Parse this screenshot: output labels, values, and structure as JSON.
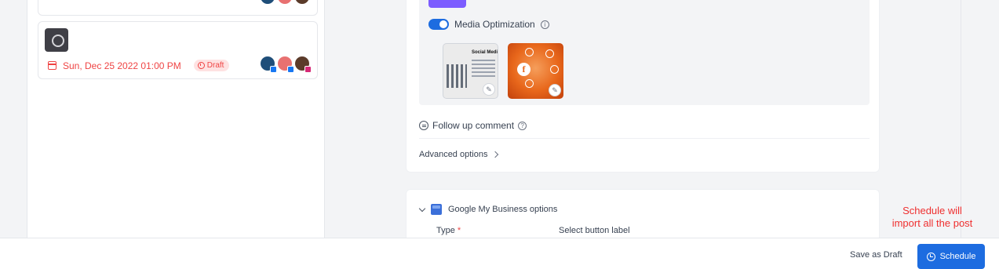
{
  "posts": [
    {
      "date": "Sun, Dec 25 2022 01:00 PM",
      "status": "Draft"
    }
  ],
  "media": {
    "toggle_label": "Media Optimization",
    "image1_title": "Social Medi"
  },
  "follow_up": {
    "label": "Follow up comment"
  },
  "advanced": {
    "label": "Advanced options"
  },
  "gmb": {
    "title": "Google My Business options",
    "type_label": "Type",
    "required_mark": "*",
    "button_label": "Select button label"
  },
  "annotation": "Schedule will import all the post",
  "footer": {
    "save_draft": "Save as Draft",
    "schedule": "Schedule"
  },
  "colors": {
    "primary": "#1d6ce0",
    "danger": "#ef4444",
    "accent_purple": "#7c5cff"
  }
}
